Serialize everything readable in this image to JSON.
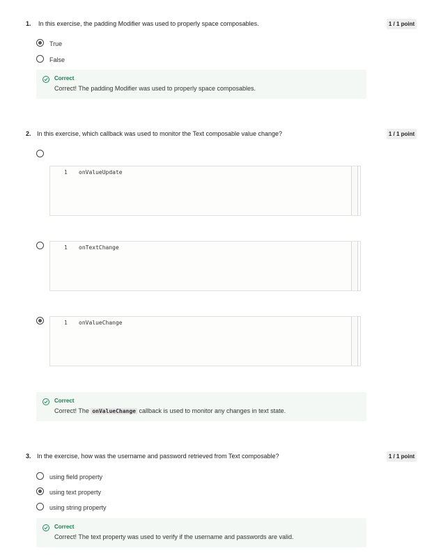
{
  "questions": [
    {
      "number": "1.",
      "text": "In this exercise, the padding Modifier was used to properly space composables.",
      "points": "1 / 1 point",
      "options": [
        {
          "label": "True",
          "selected": true
        },
        {
          "label": "False",
          "selected": false
        }
      ],
      "feedback": {
        "title": "Correct",
        "body": "Correct! The padding Modifier was used to properly space composables."
      }
    },
    {
      "number": "2.",
      "text": "In this exercise, which callback was used to monitor the Text composable value change?",
      "points": "1 / 1 point",
      "options": [
        {
          "line": "1",
          "code": "onValueUpdate",
          "selected": false
        },
        {
          "line": "1",
          "code": "onTextChange",
          "selected": false
        },
        {
          "line": "1",
          "code": "onValueChange",
          "selected": true
        }
      ],
      "feedback": {
        "title": "Correct",
        "body_prefix": "Correct! The ",
        "body_code": "onValueChange",
        "body_suffix": " callback is used to monitor any changes in text state."
      }
    },
    {
      "number": "3.",
      "text": "In the exercise, how was the username and password retrieved from Text composable?",
      "points": "1 / 1 point",
      "options": [
        {
          "label": "using field property",
          "selected": false
        },
        {
          "label": "using text property",
          "selected": true
        },
        {
          "label": "using string property",
          "selected": false
        }
      ],
      "feedback": {
        "title": "Correct",
        "body": "Correct! The text property was used to verify if the username and passwords are valid."
      }
    }
  ],
  "colors": {
    "correct_green": "#1e7a4e",
    "feedback_bg": "#f3f8f5",
    "points_badge_bg": "#eeeeee"
  }
}
